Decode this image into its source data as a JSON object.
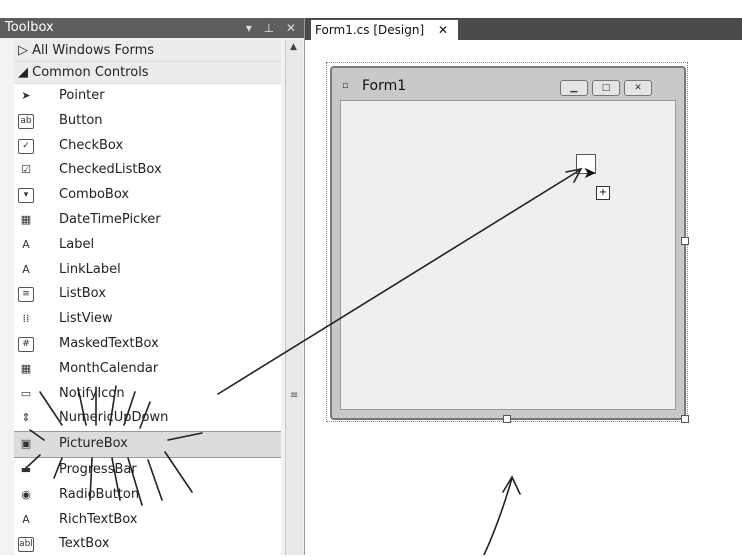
{
  "toolbox": {
    "title": "Toolbox",
    "header_icons": "▾ ⊥ ✕",
    "groups": [
      {
        "label": "▷ All Windows Forms"
      },
      {
        "label": "◢ Common Controls"
      }
    ],
    "items": [
      {
        "label": "Pointer",
        "icon": "pointer-icon",
        "glyph": "➤"
      },
      {
        "label": "Button",
        "icon": "button-icon",
        "glyph": "ab"
      },
      {
        "label": "CheckBox",
        "icon": "checkbox-icon",
        "glyph": "✓"
      },
      {
        "label": "CheckedListBox",
        "icon": "checkedlistbox-icon",
        "glyph": "☑"
      },
      {
        "label": "ComboBox",
        "icon": "combobox-icon",
        "glyph": "▾"
      },
      {
        "label": "DateTimePicker",
        "icon": "datetimepicker-icon",
        "glyph": "▦"
      },
      {
        "label": "Label",
        "icon": "label-icon",
        "glyph": "A"
      },
      {
        "label": "LinkLabel",
        "icon": "linklabel-icon",
        "glyph": "A"
      },
      {
        "label": "ListBox",
        "icon": "listbox-icon",
        "glyph": "≡"
      },
      {
        "label": "ListView",
        "icon": "listview-icon",
        "glyph": "⁞⁞"
      },
      {
        "label": "MaskedTextBox",
        "icon": "maskedtextbox-icon",
        "glyph": "#"
      },
      {
        "label": "MonthCalendar",
        "icon": "monthcalendar-icon",
        "glyph": "▦"
      },
      {
        "label": "NotifyIcon",
        "icon": "notifyicon-icon",
        "glyph": "▭"
      },
      {
        "label": "NumericUpDown",
        "icon": "numericupdown-icon",
        "glyph": "⇕"
      },
      {
        "label": "PictureBox",
        "icon": "picturebox-icon",
        "glyph": "▣",
        "selected": true
      },
      {
        "label": "ProgressBar",
        "icon": "progressbar-icon",
        "glyph": "▬"
      },
      {
        "label": "RadioButton",
        "icon": "radiobutton-icon",
        "glyph": "◉"
      },
      {
        "label": "RichTextBox",
        "icon": "richtextbox-icon",
        "glyph": "A"
      },
      {
        "label": "TextBox",
        "icon": "textbox-icon",
        "glyph": "abl"
      }
    ],
    "scroll_up": "▲",
    "grip": "≡"
  },
  "editor": {
    "tab_label": "Form1.cs [Design]",
    "tab_close": "✕"
  },
  "form": {
    "title": "Form1",
    "icon_glyph": "▫",
    "btn_min": "▁",
    "btn_max": "□",
    "btn_close": "✕",
    "drop_plus": "+"
  }
}
